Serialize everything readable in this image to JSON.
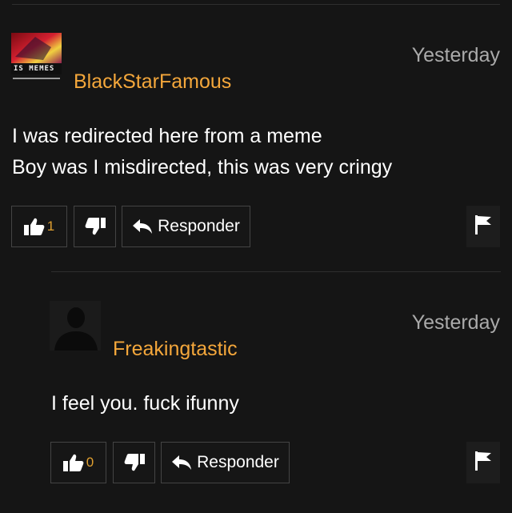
{
  "comments": [
    {
      "username": "BlackStarFamous",
      "timestamp": "Yesterday",
      "lines": [
        "I was redirected here from a meme",
        "Boy was I misdirected, this was very cringy"
      ],
      "likes": "1",
      "reply_label": "Responder",
      "avatar_text": "IS MEMES"
    },
    {
      "username": "Freakingtastic",
      "timestamp": "Yesterday",
      "lines": [
        "I feel you. fuck ifunny"
      ],
      "likes": "0",
      "reply_label": "Responder"
    }
  ],
  "colors": {
    "username": "#f4a73b",
    "count": "#e0a030",
    "background": "#151515",
    "button_border": "#444444"
  },
  "icons": [
    "thumbs-up-icon",
    "thumbs-down-icon",
    "reply-arrow-icon",
    "flag-icon"
  ]
}
